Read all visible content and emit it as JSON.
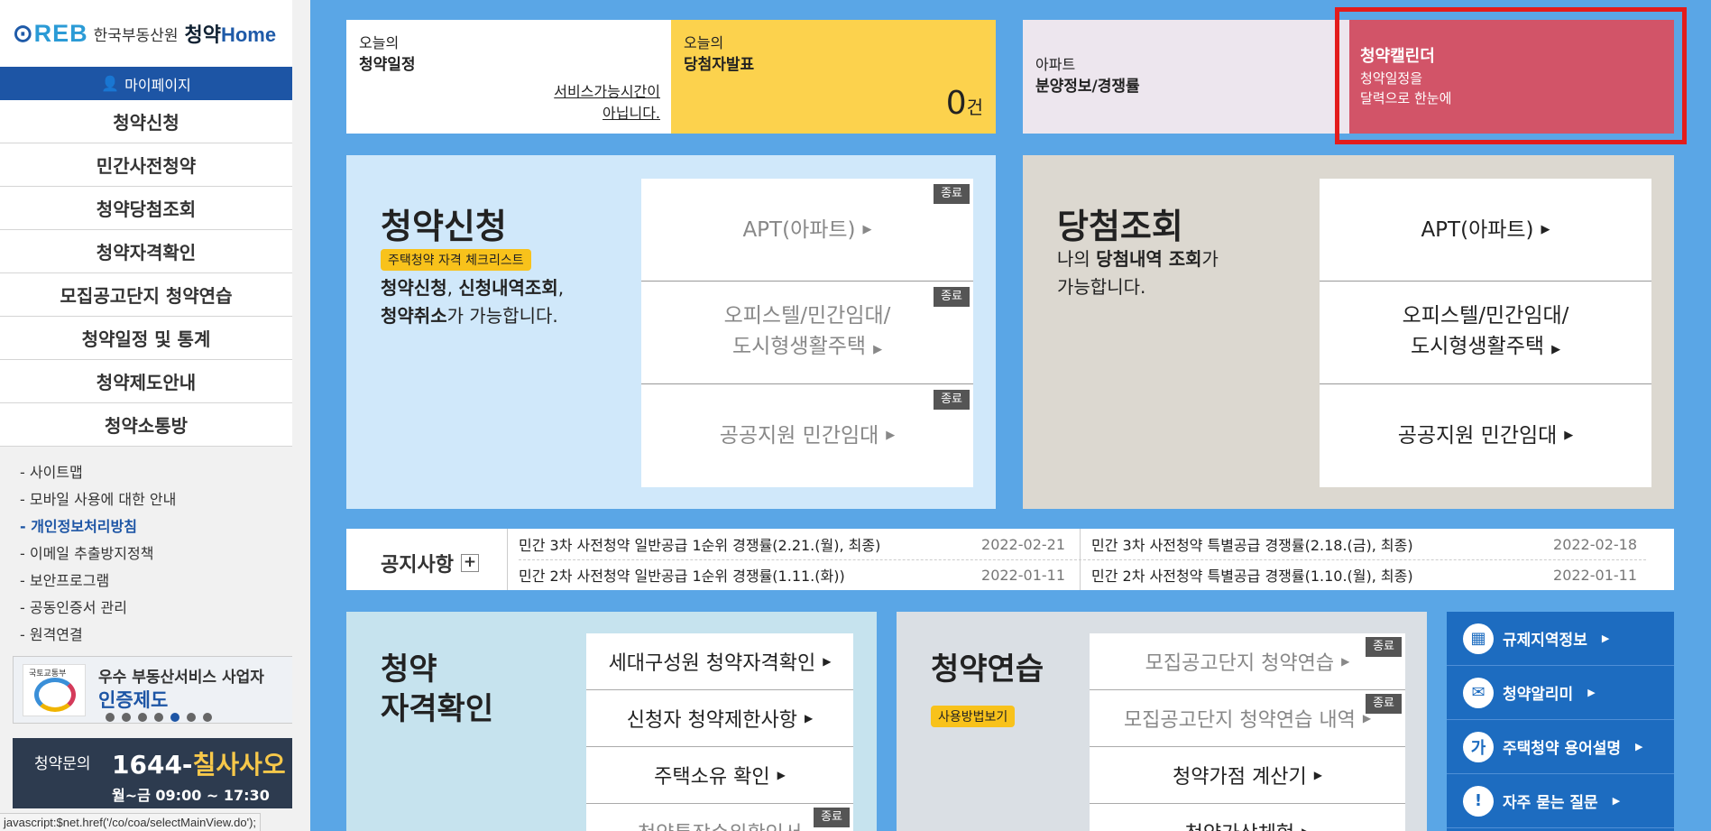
{
  "brand": {
    "logo_text": "REB",
    "org_name": "한국부동산원",
    "service_name_kr": "청약",
    "service_name_en": "Home"
  },
  "sidebar": {
    "mypage_label": "마이페이지",
    "menu": [
      {
        "label": "청약신청"
      },
      {
        "label": "민간사전청약"
      },
      {
        "label": "청약당첨조회"
      },
      {
        "label": "청약자격확인"
      },
      {
        "label": "모집공고단지 청약연습"
      },
      {
        "label": "청약일정 및 통계"
      },
      {
        "label": "청약제도안내"
      },
      {
        "label": "청약소통방"
      }
    ],
    "sub_links": [
      {
        "label": "- 사이트맵"
      },
      {
        "label": "- 모바일 사용에 대한 안내"
      },
      {
        "label": "- 개인정보처리방침"
      },
      {
        "label": "- 이메일 추출방지정책"
      },
      {
        "label": "- 보안프로그램"
      },
      {
        "label": "- 공동인증서 관리"
      },
      {
        "label": "- 원격연결"
      }
    ],
    "banner": {
      "gov_label": "국토교통부",
      "line1": "우수 부동산서비스 사업자",
      "line2": "인증제도"
    },
    "contact": {
      "label": "청약문의",
      "number_prefix": "1644-",
      "number_word": "칠사사오",
      "hours": "월~금 09:00 ~ 17:30"
    }
  },
  "status_bar": "javascript:$net.href('/co/coa/selectMainView.do');",
  "top": {
    "schedule": {
      "line1": "오늘의",
      "line2": "청약일정",
      "message1": "서비스가능시간이",
      "message2": "아닙니다."
    },
    "winner": {
      "line1": "오늘의",
      "line2": "당첨자발표",
      "count": "0",
      "unit": "건"
    },
    "apt_info": {
      "line1": "아파트",
      "line2": "분양정보/경쟁률"
    },
    "calendar": {
      "title": "청약캘린더",
      "desc1": "청약일정을",
      "desc2": "달력으로 한눈에"
    }
  },
  "apply_panel": {
    "title": "청약신청",
    "tag": "주택청약 자격 체크리스트",
    "desc_b1": "청약신청",
    "desc_t1": ", ",
    "desc_b2": "신청내역조회",
    "desc_t2": ",",
    "desc_b3": "청약취소",
    "desc_t3": "가 가능합니다.",
    "end_label": "종료",
    "options": [
      {
        "label": "APT(아파트)"
      },
      {
        "label1": "오피스텔/민간임대/",
        "label2": "도시형생활주택"
      },
      {
        "label": "공공지원 민간임대"
      }
    ]
  },
  "winner_panel": {
    "title": "당첨조회",
    "desc_t0": "나의 ",
    "desc_b1": "당첨내역 조회",
    "desc_t1": "가",
    "desc_t2": "가능합니다.",
    "options": [
      {
        "label": "APT(아파트)"
      },
      {
        "label1": "오피스텔/민간임대/",
        "label2": "도시형생활주택"
      },
      {
        "label": "공공지원 민간임대"
      }
    ]
  },
  "notice": {
    "title": "공지사항",
    "plus": "+",
    "items": [
      {
        "text": "민간 3차 사전청약 일반공급 1순위 경쟁률(2.21.(월), 최종)",
        "date": "2022-02-21"
      },
      {
        "text": "민간 3차 사전청약 특별공급 경쟁률(2.18.(금), 최종)",
        "date": "2022-02-18"
      },
      {
        "text": "민간 2차 사전청약 일반공급 1순위 경쟁률(1.11.(화))",
        "date": "2022-01-11"
      },
      {
        "text": "민간 2차 사전청약 특별공급 경쟁률(1.10.(월), 최종)",
        "date": "2022-01-11"
      }
    ]
  },
  "qual_panel": {
    "title1": "청약",
    "title2": "자격확인",
    "items": [
      {
        "label": "세대구성원 청약자격확인"
      },
      {
        "label": "신청자 청약제한사항"
      },
      {
        "label": "주택소유 확인"
      },
      {
        "label": "청약통장순위확인서"
      }
    ]
  },
  "prac_panel": {
    "title": "청약연습",
    "tag": "사용방법보기",
    "items": [
      {
        "label": "모집공고단지 청약연습"
      },
      {
        "label": "모집공고단지 청약연습 내역"
      },
      {
        "label": "청약가점 계산기"
      },
      {
        "label": "청약가상체험"
      }
    ]
  },
  "side_menu": {
    "items": [
      {
        "label": "규제지역정보",
        "icon": "building-icon",
        "glyph": "▦"
      },
      {
        "label": "청약알리미",
        "icon": "mail-icon",
        "glyph": "✉"
      },
      {
        "label": "주택청약 용어설명",
        "icon": "glossary-icon",
        "glyph": "가"
      },
      {
        "label": "자주 묻는 질문",
        "icon": "faq-icon",
        "glyph": "!"
      }
    ]
  },
  "colors": {
    "background": "#5aa6e6",
    "primary": "#1d55a5",
    "winner_yellow": "#fcd24d",
    "calendar_red": "#d25468",
    "highlight_red": "#e31c1c"
  }
}
